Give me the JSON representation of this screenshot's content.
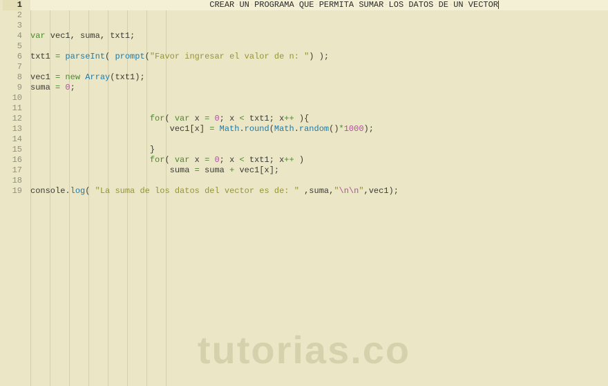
{
  "watermark": "tutorias.co",
  "gutter": {
    "start": 1,
    "end": 19
  },
  "currentLine": 1,
  "lines": [
    {
      "indent": 36,
      "segs": [
        {
          "t": "CREAR",
          "c": "header"
        },
        {
          "t": "·",
          "c": "dot"
        },
        {
          "t": "UN",
          "c": "header"
        },
        {
          "t": "·",
          "c": "dot"
        },
        {
          "t": "PROGRAMA",
          "c": "header"
        },
        {
          "t": "·",
          "c": "dot"
        },
        {
          "t": "QUE",
          "c": "header"
        },
        {
          "t": "·",
          "c": "dot"
        },
        {
          "t": "PERMITA",
          "c": "header"
        },
        {
          "t": "·",
          "c": "dot"
        },
        {
          "t": "SUMAR",
          "c": "header"
        },
        {
          "t": "·",
          "c": "dot"
        },
        {
          "t": "LOS",
          "c": "header"
        },
        {
          "t": "·",
          "c": "dot"
        },
        {
          "t": "DATOS",
          "c": "header"
        },
        {
          "t": "·",
          "c": "dot"
        },
        {
          "t": "DE",
          "c": "header"
        },
        {
          "t": "·",
          "c": "dot"
        },
        {
          "t": "UN",
          "c": "header"
        },
        {
          "t": "·",
          "c": "dot"
        },
        {
          "t": "VECTOR",
          "c": "header"
        },
        {
          "t": "",
          "c": "cursor-mark"
        }
      ]
    },
    {
      "indent": 0,
      "segs": []
    },
    {
      "indent": 0,
      "segs": []
    },
    {
      "indent": 0,
      "segs": [
        {
          "t": "var",
          "c": "kw"
        },
        {
          "t": " vec1, suma, txt1;",
          "c": "id"
        }
      ]
    },
    {
      "indent": 0,
      "segs": []
    },
    {
      "indent": 0,
      "segs": [
        {
          "t": "txt1 ",
          "c": "id"
        },
        {
          "t": "=",
          "c": "op"
        },
        {
          "t": " ",
          "c": "id"
        },
        {
          "t": "parseInt",
          "c": "func"
        },
        {
          "t": "( ",
          "c": "punc"
        },
        {
          "t": "prompt",
          "c": "func"
        },
        {
          "t": "(",
          "c": "punc"
        },
        {
          "t": "\"Favor ingresar el valor de n: \"",
          "c": "str"
        },
        {
          "t": ") );",
          "c": "punc"
        }
      ]
    },
    {
      "indent": 0,
      "segs": []
    },
    {
      "indent": 0,
      "segs": [
        {
          "t": "vec1 ",
          "c": "id"
        },
        {
          "t": "=",
          "c": "op"
        },
        {
          "t": " ",
          "c": "id"
        },
        {
          "t": "new",
          "c": "kw"
        },
        {
          "t": " ",
          "c": "id"
        },
        {
          "t": "Array",
          "c": "func"
        },
        {
          "t": "(txt1);",
          "c": "id"
        }
      ]
    },
    {
      "indent": 0,
      "segs": [
        {
          "t": "suma ",
          "c": "id"
        },
        {
          "t": "=",
          "c": "op"
        },
        {
          "t": " ",
          "c": "id"
        },
        {
          "t": "0",
          "c": "num"
        },
        {
          "t": ";",
          "c": "punc"
        }
      ]
    },
    {
      "indent": 0,
      "segs": []
    },
    {
      "indent": 0,
      "segs": []
    },
    {
      "indent": 24,
      "segs": [
        {
          "t": "for",
          "c": "kw"
        },
        {
          "t": "( ",
          "c": "punc"
        },
        {
          "t": "var",
          "c": "kw"
        },
        {
          "t": " x ",
          "c": "id"
        },
        {
          "t": "=",
          "c": "op"
        },
        {
          "t": " ",
          "c": "id"
        },
        {
          "t": "0",
          "c": "num"
        },
        {
          "t": "; x ",
          "c": "id"
        },
        {
          "t": "<",
          "c": "op"
        },
        {
          "t": " txt1; x",
          "c": "id"
        },
        {
          "t": "++",
          "c": "op"
        },
        {
          "t": " ){",
          "c": "punc"
        }
      ]
    },
    {
      "indent": 28,
      "segs": [
        {
          "t": "vec1[x] ",
          "c": "id"
        },
        {
          "t": "=",
          "c": "op"
        },
        {
          "t": " ",
          "c": "id"
        },
        {
          "t": "Math",
          "c": "func"
        },
        {
          "t": ".",
          "c": "punc"
        },
        {
          "t": "round",
          "c": "func"
        },
        {
          "t": "(",
          "c": "punc"
        },
        {
          "t": "Math",
          "c": "func"
        },
        {
          "t": ".",
          "c": "punc"
        },
        {
          "t": "random",
          "c": "func"
        },
        {
          "t": "()",
          "c": "punc"
        },
        {
          "t": "*",
          "c": "op"
        },
        {
          "t": "1000",
          "c": "num"
        },
        {
          "t": ");",
          "c": "punc"
        }
      ]
    },
    {
      "indent": 0,
      "segs": []
    },
    {
      "indent": 24,
      "segs": [
        {
          "t": "}",
          "c": "punc"
        }
      ]
    },
    {
      "indent": 24,
      "segs": [
        {
          "t": "for",
          "c": "kw"
        },
        {
          "t": "( ",
          "c": "punc"
        },
        {
          "t": "var",
          "c": "kw"
        },
        {
          "t": " x ",
          "c": "id"
        },
        {
          "t": "=",
          "c": "op"
        },
        {
          "t": " ",
          "c": "id"
        },
        {
          "t": "0",
          "c": "num"
        },
        {
          "t": "; x ",
          "c": "id"
        },
        {
          "t": "<",
          "c": "op"
        },
        {
          "t": " txt1; x",
          "c": "id"
        },
        {
          "t": "++",
          "c": "op"
        },
        {
          "t": " )",
          "c": "punc"
        }
      ]
    },
    {
      "indent": 28,
      "segs": [
        {
          "t": "suma ",
          "c": "id"
        },
        {
          "t": "=",
          "c": "op"
        },
        {
          "t": " suma ",
          "c": "id"
        },
        {
          "t": "+",
          "c": "op"
        },
        {
          "t": " vec1[x];",
          "c": "id"
        }
      ]
    },
    {
      "indent": 0,
      "segs": []
    },
    {
      "indent": 0,
      "segs": [
        {
          "t": "console",
          "c": "id"
        },
        {
          "t": ".",
          "c": "punc"
        },
        {
          "t": "log",
          "c": "func"
        },
        {
          "t": "( ",
          "c": "punc"
        },
        {
          "t": "\"La suma de los datos del vector es de: \"",
          "c": "str"
        },
        {
          "t": " ,suma,",
          "c": "id"
        },
        {
          "t": "\"",
          "c": "str"
        },
        {
          "t": "\\n\\n",
          "c": "esc"
        },
        {
          "t": "\"",
          "c": "str"
        },
        {
          "t": ",vec1);",
          "c": "id"
        }
      ]
    }
  ],
  "guides": [
    0,
    28,
    56,
    84,
    112,
    140,
    168,
    196
  ]
}
